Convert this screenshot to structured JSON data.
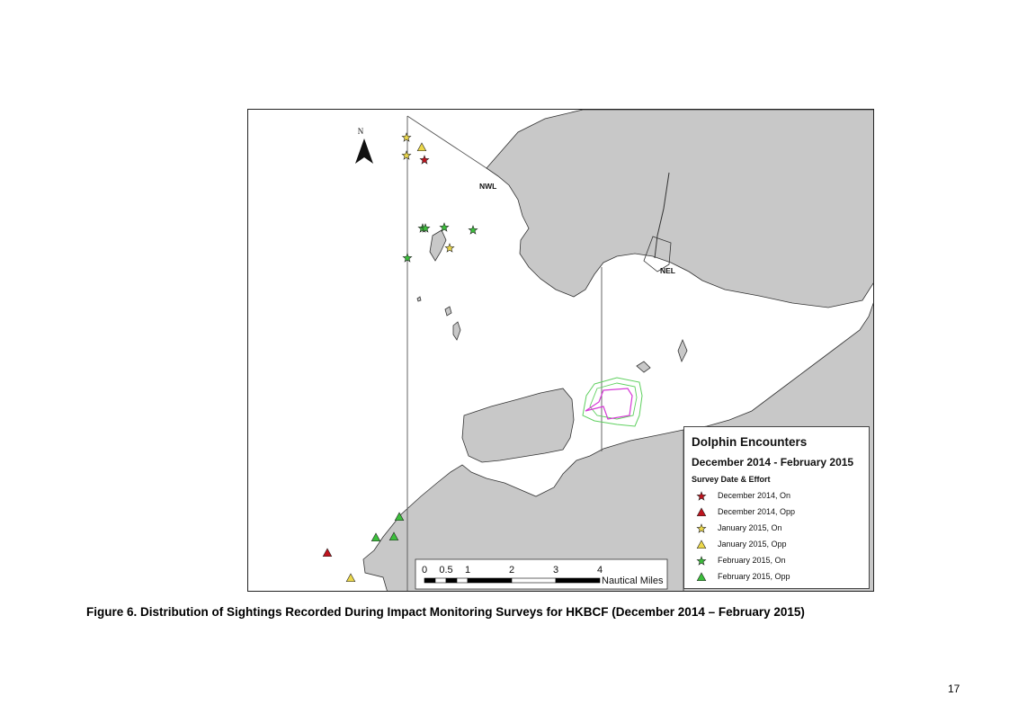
{
  "map": {
    "north_label": "N",
    "region_labels": [
      {
        "id": "nwl",
        "text": "NWL"
      },
      {
        "id": "nel",
        "text": "NEL"
      }
    ],
    "scale_bar": {
      "ticks": [
        "0",
        "0.5",
        "1",
        "2",
        "3",
        "4"
      ],
      "unit": "Nautical Miles"
    },
    "colors": {
      "land": "#c8c8c8",
      "water": "#ffffff",
      "coast": "#333333",
      "works_outer": "#5fd05f",
      "works_inner": "#d63ad6"
    }
  },
  "legend": {
    "title": "Dolphin Encounters",
    "subtitle": "December 2014 - February 2015",
    "section": "Survey Date & Effort",
    "items": [
      {
        "label": "December 2014, On",
        "symbol": "star",
        "color": "#c0141e"
      },
      {
        "label": "December 2014, Opp",
        "symbol": "triangle",
        "color": "#c0141e"
      },
      {
        "label": "January 2015, On",
        "symbol": "star",
        "color": "#ecd84a"
      },
      {
        "label": "January 2015, Opp",
        "symbol": "triangle",
        "color": "#ecd84a"
      },
      {
        "label": "February 2015, On",
        "symbol": "star",
        "color": "#3cbf3c"
      },
      {
        "label": "February 2015, Opp",
        "symbol": "triangle",
        "color": "#3cbf3c"
      }
    ]
  },
  "sightings": [
    {
      "series": 2,
      "name": "sighting-jan-on-1"
    },
    {
      "series": 3,
      "name": "sighting-jan-opp-1"
    },
    {
      "series": 2,
      "name": "sighting-jan-on-2"
    },
    {
      "series": 0,
      "name": "sighting-dec-on-1"
    },
    {
      "series": 4,
      "name": "sighting-feb-on-1"
    },
    {
      "series": 4,
      "name": "sighting-feb-on-2"
    },
    {
      "series": 4,
      "name": "sighting-feb-on-3"
    },
    {
      "series": 4,
      "name": "sighting-feb-on-4"
    },
    {
      "series": 2,
      "name": "sighting-jan-on-3"
    },
    {
      "series": 4,
      "name": "sighting-feb-on-5"
    },
    {
      "series": 5,
      "name": "sighting-feb-opp-1"
    },
    {
      "series": 5,
      "name": "sighting-feb-opp-2"
    },
    {
      "series": 5,
      "name": "sighting-feb-opp-3"
    },
    {
      "series": 1,
      "name": "sighting-dec-opp-1"
    },
    {
      "series": 3,
      "name": "sighting-jan-opp-2"
    }
  ],
  "caption": "Figure 6. Distribution of Sightings Recorded During Impact Monitoring Surveys for HKBCF (December 2014 – February 2015)",
  "page_number": "17"
}
